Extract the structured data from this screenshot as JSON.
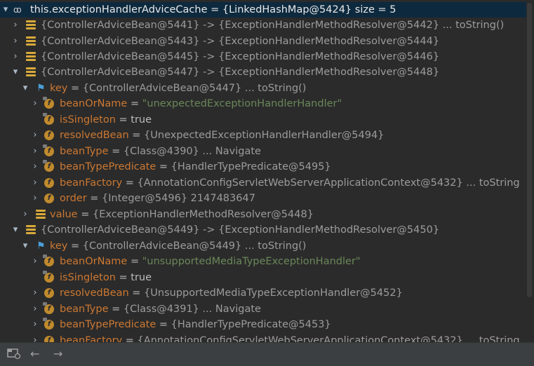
{
  "header": {
    "name": "this.exceptionHandlerAdviceCache",
    "eq": "=",
    "value": "{LinkedHashMap@5424}",
    "size": "size = 5"
  },
  "entries": [
    {
      "key": "{ControllerAdviceBean@5441}",
      "arrow": "->",
      "value": "{ExceptionHandlerMethodResolver@5442}",
      "suffix": "... toString()"
    },
    {
      "key": "{ControllerAdviceBean@5443}",
      "arrow": "->",
      "value": "{ExceptionHandlerMethodResolver@5444}",
      "suffix": ""
    },
    {
      "key": "{ControllerAdviceBean@5445}",
      "arrow": "->",
      "value": "{ExceptionHandlerMethodResolver@5446}",
      "suffix": ""
    },
    {
      "key": "{ControllerAdviceBean@5447}",
      "arrow": "->",
      "value": "{ExceptionHandlerMethodResolver@5448}",
      "suffix": ""
    },
    {
      "key": "{ControllerAdviceBean@5449}",
      "arrow": "->",
      "value": "{ExceptionHandlerMethodResolver@5450}",
      "suffix": ""
    }
  ],
  "group1": {
    "key": {
      "name": "key",
      "eq": "=",
      "value": "{ControllerAdviceBean@5447}",
      "suffix": "... toString()"
    },
    "fields": [
      {
        "name": "beanOrName",
        "eq": "=",
        "value": "\"unexpectedExceptionHandlerHandler\""
      },
      {
        "name": "isSingleton",
        "eq": "=",
        "value": "true"
      },
      {
        "name": "resolvedBean",
        "eq": "=",
        "value": "{UnexpectedExceptionHandlerHandler@5494}"
      },
      {
        "name": "beanType",
        "eq": "=",
        "value": "{Class@4390}",
        "suffix": "... Navigate"
      },
      {
        "name": "beanTypePredicate",
        "eq": "=",
        "value": "{HandlerTypePredicate@5495}"
      },
      {
        "name": "beanFactory",
        "eq": "=",
        "value": "{AnnotationConfigServletWebServerApplicationContext@5432}",
        "suffix": "... toString"
      },
      {
        "name": "order",
        "eq": "=",
        "value": "{Integer@5496} 2147483647"
      }
    ],
    "valueRow": {
      "name": "value",
      "eq": "=",
      "value": "{ExceptionHandlerMethodResolver@5448}"
    }
  },
  "group2": {
    "key": {
      "name": "key",
      "eq": "=",
      "value": "{ControllerAdviceBean@5449}",
      "suffix": "... toString()"
    },
    "fields": [
      {
        "name": "beanOrName",
        "eq": "=",
        "value": "\"unsupportedMediaTypeExceptionHandler\""
      },
      {
        "name": "isSingleton",
        "eq": "=",
        "value": "true"
      },
      {
        "name": "resolvedBean",
        "eq": "=",
        "value": "{UnsupportedMediaTypeExceptionHandler@5452}"
      },
      {
        "name": "beanType",
        "eq": "=",
        "value": "{Class@4391}",
        "suffix": "... Navigate"
      },
      {
        "name": "beanTypePredicate",
        "eq": "=",
        "value": "{HandlerTypePredicate@5453}"
      },
      {
        "name": "beanFactory",
        "eq": "=",
        "value": "{AnnotationConfigServletWebServerApplicationContext@5432}",
        "suffix": "... toString"
      }
    ]
  },
  "icons": {
    "header": "watch-glasses-icon",
    "entry": "map-entry-icon",
    "key": "flag-icon",
    "field": "field-icon",
    "back": "arrow-left-icon",
    "forward": "arrow-right-icon",
    "settings": "layout-settings-icon"
  },
  "colors": {
    "background": "#2b2b2b",
    "header_bg": "#0d293e",
    "field": "#cc7832",
    "string": "#6a8759",
    "ref": "#9c9c9c"
  },
  "toolbar": {
    "back": "←",
    "forward": "→"
  }
}
